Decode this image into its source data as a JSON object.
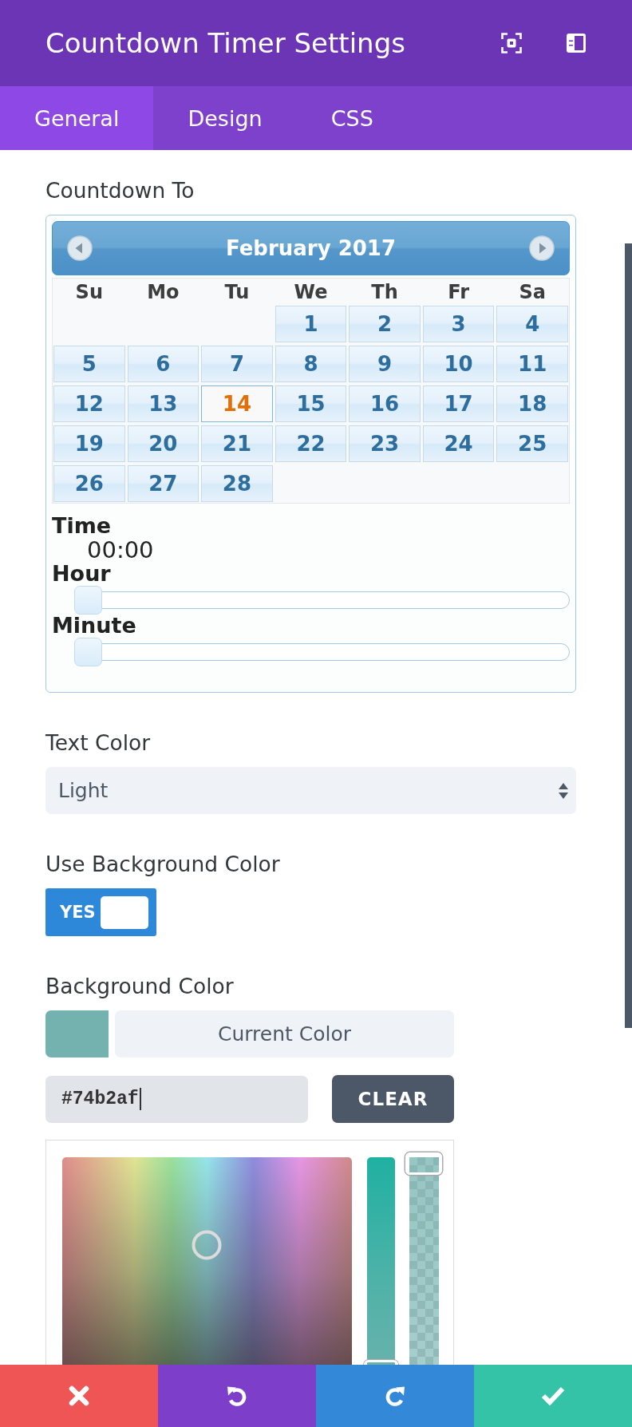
{
  "window": {
    "title": "Countdown Timer Settings"
  },
  "tabs": [
    {
      "label": "General",
      "selected": true
    },
    {
      "label": "Design",
      "selected": false
    },
    {
      "label": "CSS",
      "selected": false
    }
  ],
  "countdown_to": {
    "label": "Countdown To",
    "calendar": {
      "title": "February 2017",
      "weekdays": [
        "Su",
        "Mo",
        "Tu",
        "We",
        "Th",
        "Fr",
        "Sa"
      ],
      "weeks": [
        {
          "kind": "first",
          "days": [
            {
              "day": "1",
              "selected": false
            },
            {
              "day": "2",
              "selected": false
            },
            {
              "day": "3",
              "selected": false
            },
            {
              "day": "4",
              "selected": false
            }
          ]
        },
        {
          "kind": "full",
          "days": [
            {
              "day": "5",
              "selected": false
            },
            {
              "day": "6",
              "selected": false
            },
            {
              "day": "7",
              "selected": false
            },
            {
              "day": "8",
              "selected": false
            },
            {
              "day": "9",
              "selected": false
            },
            {
              "day": "10",
              "selected": false
            },
            {
              "day": "11",
              "selected": false
            }
          ]
        },
        {
          "kind": "full",
          "days": [
            {
              "day": "12",
              "selected": false
            },
            {
              "day": "13",
              "selected": false
            },
            {
              "day": "14",
              "selected": true
            },
            {
              "day": "15",
              "selected": false
            },
            {
              "day": "16",
              "selected": false
            },
            {
              "day": "17",
              "selected": false
            },
            {
              "day": "18",
              "selected": false
            }
          ]
        },
        {
          "kind": "full",
          "days": [
            {
              "day": "19",
              "selected": false
            },
            {
              "day": "20",
              "selected": false
            },
            {
              "day": "21",
              "selected": false
            },
            {
              "day": "22",
              "selected": false
            },
            {
              "day": "23",
              "selected": false
            },
            {
              "day": "24",
              "selected": false
            },
            {
              "day": "25",
              "selected": false
            }
          ]
        },
        {
          "kind": "last",
          "days": [
            {
              "day": "26",
              "selected": false
            },
            {
              "day": "27",
              "selected": false
            },
            {
              "day": "28",
              "selected": false
            }
          ]
        }
      ]
    },
    "time": {
      "label": "Time",
      "value": "00:00"
    },
    "sliders": [
      {
        "label": "Hour",
        "level": 0
      },
      {
        "label": "Minute",
        "level": 0
      }
    ]
  },
  "text_color": {
    "label": "Text Color",
    "value": "Light"
  },
  "use_background_color": {
    "label": "Use Background Color",
    "toggle": {
      "text": "YES",
      "on": true
    }
  },
  "background_color": {
    "label": "Background Color",
    "swatch": {
      "color": "#74b2af"
    },
    "current_color_button": "Current Color",
    "hex_value": "#74b2af",
    "clear_button": "CLEAR",
    "color_picker": {
      "color_strip": {
        "level": 0.26
      },
      "opacity_strip": {
        "level": 1
      }
    }
  }
}
